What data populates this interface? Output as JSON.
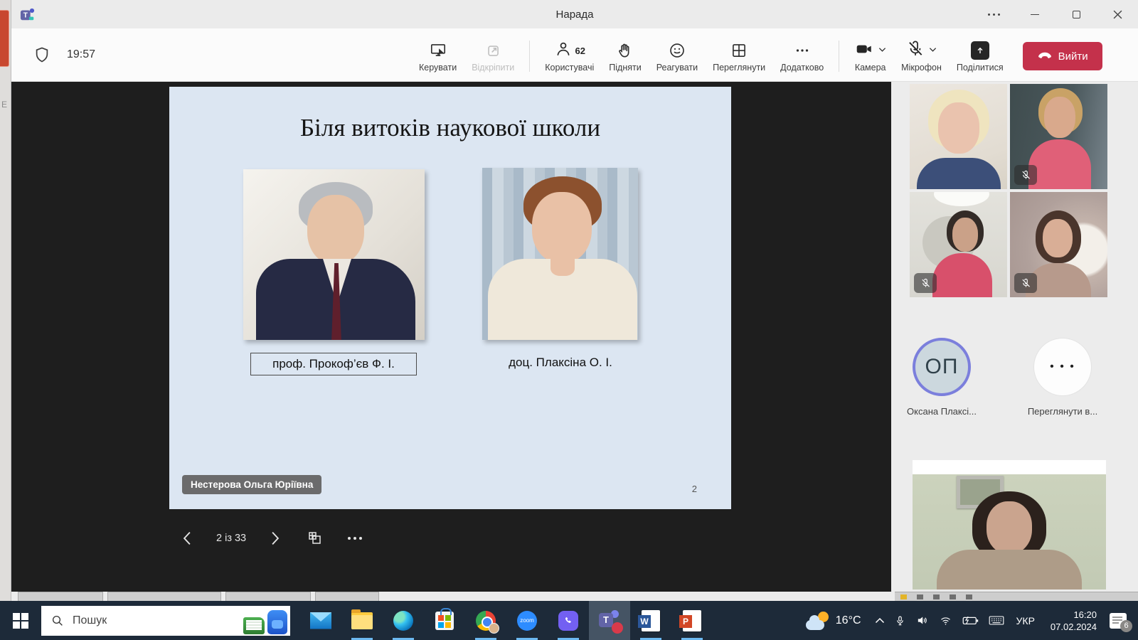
{
  "window": {
    "title": "Нарада"
  },
  "background": {
    "left_letter": "Е"
  },
  "toolbar": {
    "timer": "19:57",
    "manage": "Керувати",
    "unpin": "Відкріпити",
    "participants": "Користувачі",
    "participants_count": "62",
    "raise": "Підняти",
    "react": "Реагувати",
    "view": "Переглянути",
    "more": "Додатково",
    "camera": "Камера",
    "mic": "Мікрофон",
    "share": "Поділитися",
    "leave": "Вийти"
  },
  "slide": {
    "title": "Біля витоків наукової школи",
    "caption_left": "проф. Прокоф’єв Ф. І.",
    "caption_right": "доц. Плаксіна О. І.",
    "presenter": "Нестерова Ольга Юріївна",
    "page": "2"
  },
  "nav": {
    "position": "2 із 33"
  },
  "participants_panel": {
    "avatar_initials": "ОП",
    "avatar_name": "Оксана Плаксі...",
    "overflow_dots": "• • •",
    "overflow_label": "Переглянути в..."
  },
  "taskbar": {
    "search": "Пошук",
    "zoom_label": "zoom",
    "word_letter": "W",
    "ppt_letter": "P",
    "teams_letter": "T",
    "tray": {
      "temp": "16°C",
      "lang": "УКР",
      "time": "16:20",
      "date": "07.02.2024",
      "notifications": "6"
    }
  },
  "colors": {
    "leave_red": "#c4314b",
    "avatar_ring": "#7b7fdc",
    "taskbar_bg": "#1d2a39",
    "slide_bg": "#dce6f2",
    "underline_accent": "#6cb8f0"
  }
}
